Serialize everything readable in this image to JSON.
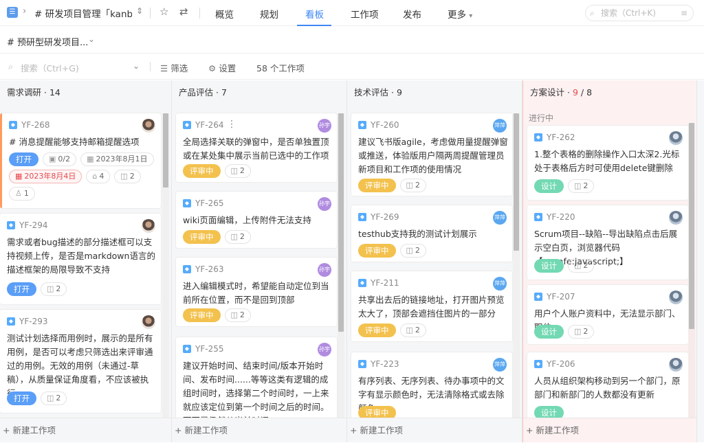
{
  "topbar": {
    "project_title": "# 研发项目管理「kanb...",
    "tabs": [
      "概览",
      "规划",
      "看板",
      "工作项",
      "发布",
      "更多"
    ],
    "active_tab": "看板",
    "search_placeholder": "搜索（Ctrl+K)"
  },
  "viewbar": {
    "view_name": "# 预研型研发项目..."
  },
  "filterbar": {
    "search_placeholder": "搜索（Ctrl+G)",
    "filter_label": "筛选",
    "settings_label": "设置",
    "count_label": "58 个工作项"
  },
  "add_item_label": "+ 新建工作项",
  "columns": [
    {
      "name": "需求调研",
      "count": "14",
      "cards": [
        {
          "id": "YF-268",
          "title": "# 消息提醒能够支持邮箱提醒选项",
          "status": "打开",
          "subtasks": "0/2",
          "date": "2023年8月1日",
          "due": "2023年8月4日",
          "links": "4",
          "comments": "2",
          "assignees": "1"
        },
        {
          "id": "YF-294",
          "title": "需求或者bug描述的部分描述框可以支持视频上传，是否是markdown语言的描述框架的局限导致不支持",
          "status": "打开",
          "comments": "2"
        },
        {
          "id": "YF-293",
          "title": "测试计划选择而用例时，展示的是所有用例，是否可以考虑只筛选出来评审通过的用例。无效的用例（未通过-草稿），从质量保证角度看，不应该被执行",
          "status": "打开",
          "comments": "2"
        }
      ]
    },
    {
      "name": "产品评估",
      "count": "7",
      "cards": [
        {
          "id": "YF-264",
          "avatar": "孙宇",
          "title": "全局选择关联的弹窗中，是否单独置顶或在某处集中展示当前已选中的工作项",
          "status": "评审中",
          "comments": "2"
        },
        {
          "id": "YF-265",
          "avatar": "孙宇",
          "title": "wiki页面编辑，上传附件无法支持",
          "status": "评审中",
          "comments": "2"
        },
        {
          "id": "YF-263",
          "avatar": "孙宇",
          "title": "进入编辑模式时，希望能自动定位到当前所在位置，而不是回到顶部",
          "status": "评审中",
          "comments": "2"
        },
        {
          "id": "YF-255",
          "avatar": "孙宇",
          "title": "建议开始时间、结束时间/版本开始时间、发布时间......等等这类有逻辑的成组时间时，选择第二个时间时，一上来就应该定位到第一个时间之后的时间。而不是仍然从当前时间"
        }
      ]
    },
    {
      "name": "技术评估",
      "count": "9",
      "cards": [
        {
          "id": "YF-260",
          "avatar": "萍萍",
          "title": "建议飞书版agile，考虑做用量提醒弹窗或推送，体验版用户隔两周提醒管理员新项目和工作项的使用情况",
          "status": "评审中",
          "comments": "2"
        },
        {
          "id": "YF-269",
          "avatar": "萍萍",
          "title": "testhub支持我的测试计划展示",
          "status": "评审中",
          "comments": "2"
        },
        {
          "id": "YF-211",
          "avatar": "萍萍",
          "title": "共享出去后的链接地址，打开图片预览太大了，顶部会遮挡住图片的一部分",
          "status": "评审中",
          "comments": "2"
        },
        {
          "id": "YF-223",
          "avatar": "萍萍",
          "title": "有序列表、无序列表、待办事项中的文字有显示颜色时，无法清除格式或去除颜色",
          "status": "评审中"
        }
      ]
    },
    {
      "name": "方案设计",
      "count": "9",
      "limit": "8",
      "substatus": "进行中",
      "cards": [
        {
          "id": "YF-262",
          "title": "1.整个表格的删除操作入口太深2.光标处于表格后方时可使用delete键删除",
          "status": "设计",
          "comments": "2"
        },
        {
          "id": "YF-220",
          "title": "Scrum项目--缺陷--导出缺陷点击后展示空白页，浏览器代码【unsafe:javascript;】",
          "status": "设计",
          "comments": "2"
        },
        {
          "id": "YF-207",
          "title": "用户个人账户资料中，无法显示部门、职位",
          "status": "设计",
          "comments": "2"
        },
        {
          "id": "YF-206",
          "title": "人员从组织架构移动到另一个部门，原部门和新部门的人数都没有更新",
          "status": "设计"
        }
      ]
    }
  ]
}
